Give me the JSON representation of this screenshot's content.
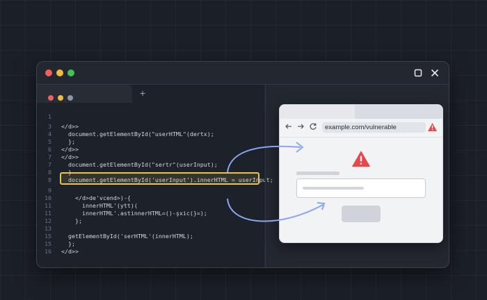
{
  "window": {
    "controls": {
      "close_color": "#f25f5c",
      "minimize_color": "#f2bd3c",
      "maximize_color": "#3fc454"
    },
    "actions": [
      "maximize-icon",
      "close-icon"
    ]
  },
  "editor": {
    "tab_controls": {
      "close_color": "#f25f5c",
      "minimize_color": "#f2bd3c",
      "other_color": "#8e96a3"
    },
    "new_tab_label": "+",
    "lines": [
      {
        "n": "1",
        "text": ""
      },
      {
        "n": "3",
        "text": "</d>>"
      },
      {
        "n": "4",
        "text": "  document.getElementById(\"userHTML\"(dertx);"
      },
      {
        "n": "5",
        "text": "  };"
      },
      {
        "n": "6",
        "text": "</d>>"
      },
      {
        "n": "7",
        "text": "</d>>"
      },
      {
        "n": "7",
        "text": "  document.getElementById(\"sertr\"(userInput);"
      },
      {
        "n": "8",
        "text": "  }"
      },
      {
        "n": "8",
        "text": "  document.getElementById('userInput').innerHTML = userInput;"
      },
      {
        "n": "9",
        "text": ""
      },
      {
        "n": "10",
        "text": "    </d>de'vcend>)-{"
      },
      {
        "n": "11",
        "text": "      innerHTML'(ytt)("
      },
      {
        "n": "11",
        "text": "      innerHTML'.astinnerHTML=()-şxic(}=);"
      },
      {
        "n": "12",
        "text": "    };"
      },
      {
        "n": "13",
        "text": ""
      },
      {
        "n": "15",
        "text": "  getElementById('serHTML'(innerHTML);"
      },
      {
        "n": "15",
        "text": "  };"
      },
      {
        "n": "16",
        "text": "</d>>"
      }
    ]
  },
  "browser": {
    "address": "example.com/vulnerable",
    "nav_icons": [
      "back-arrow-icon",
      "forward-arrow-icon",
      "reload-icon"
    ],
    "warning_color": "#e5484d"
  },
  "colors": {
    "arrow": "#8aa6ee",
    "highlight": "#e6c552"
  }
}
